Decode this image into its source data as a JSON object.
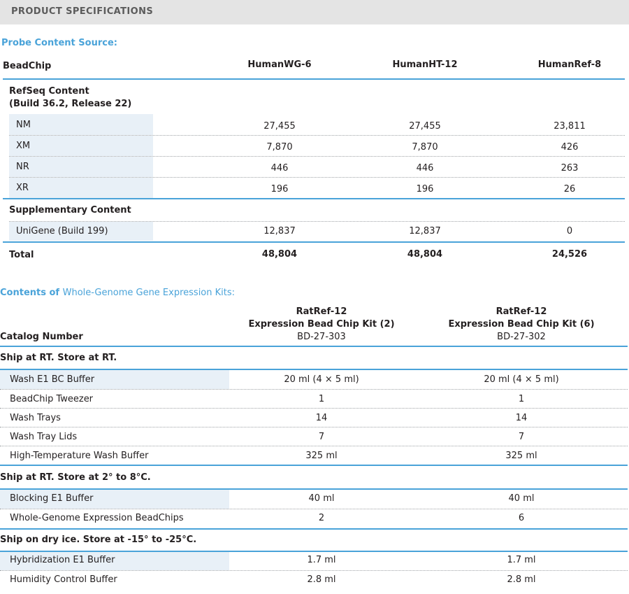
{
  "header": {
    "title": "PRODUCT SPECIFICATIONS"
  },
  "probe": {
    "title": "Probe Content Source:",
    "col_label": "BeadChip",
    "columns": [
      "HumanWG-6",
      "HumanHT-12",
      "HumanRef-8"
    ],
    "refseq_title": "RefSeq Content",
    "refseq_subtitle": "(Build 36.2, Release 22)",
    "refseq_rows": [
      {
        "label": "NM",
        "values": [
          "27,455",
          "27,455",
          "23,811"
        ]
      },
      {
        "label": "XM",
        "values": [
          "7,870",
          "7,870",
          "426"
        ]
      },
      {
        "label": "NR",
        "values": [
          "446",
          "446",
          "263"
        ]
      },
      {
        "label": "XR",
        "values": [
          "196",
          "196",
          "26"
        ]
      }
    ],
    "supp_title": "Supplementary Content",
    "supp_rows": [
      {
        "label": "UniGene (Build 199)",
        "values": [
          "12,837",
          "12,837",
          "0"
        ]
      }
    ],
    "total": {
      "label": "Total",
      "values": [
        "48,804",
        "48,804",
        "24,526"
      ]
    }
  },
  "kits": {
    "title_part1": "Contents of",
    "title_part2": "Whole-Genome Gene Expression Kits:",
    "catalog_label": "Catalog Number",
    "columns": [
      {
        "name1": "RatRef-12",
        "name2": "Expression Bead Chip Kit (2)",
        "catalog": "BD-27-303"
      },
      {
        "name1": "RatRef-12",
        "name2": "Expression Bead Chip Kit (6)",
        "catalog": "BD-27-302"
      }
    ],
    "groups": [
      {
        "title": "Ship at RT. Store at RT.",
        "rows": [
          {
            "label": "Wash E1 BC Buffer",
            "values": [
              "20 ml (4 × 5 ml)",
              "20 ml (4 × 5 ml)"
            ]
          },
          {
            "label": "BeadChip Tweezer",
            "values": [
              "1",
              "1"
            ]
          },
          {
            "label": "Wash Trays",
            "values": [
              "14",
              "14"
            ]
          },
          {
            "label": "Wash Tray Lids",
            "values": [
              "7",
              "7"
            ]
          },
          {
            "label": "High-Temperature Wash Buffer",
            "values": [
              "325 ml",
              "325 ml"
            ]
          }
        ]
      },
      {
        "title": "Ship at RT. Store at 2° to 8°C.",
        "rows": [
          {
            "label": "Blocking E1 Buffer",
            "values": [
              "40 ml",
              "40 ml"
            ]
          },
          {
            "label": "Whole-Genome Expression BeadChips",
            "values": [
              "2",
              "6"
            ]
          }
        ]
      },
      {
        "title": "Ship on dry ice. Store at -15° to -25°C.",
        "rows": [
          {
            "label": "Hybridization E1 Buffer",
            "values": [
              "1.7 ml",
              "1.7 ml"
            ]
          },
          {
            "label": "Humidity Control Buffer",
            "values": [
              "2.8 ml",
              "2.8 ml"
            ]
          }
        ]
      }
    ]
  }
}
